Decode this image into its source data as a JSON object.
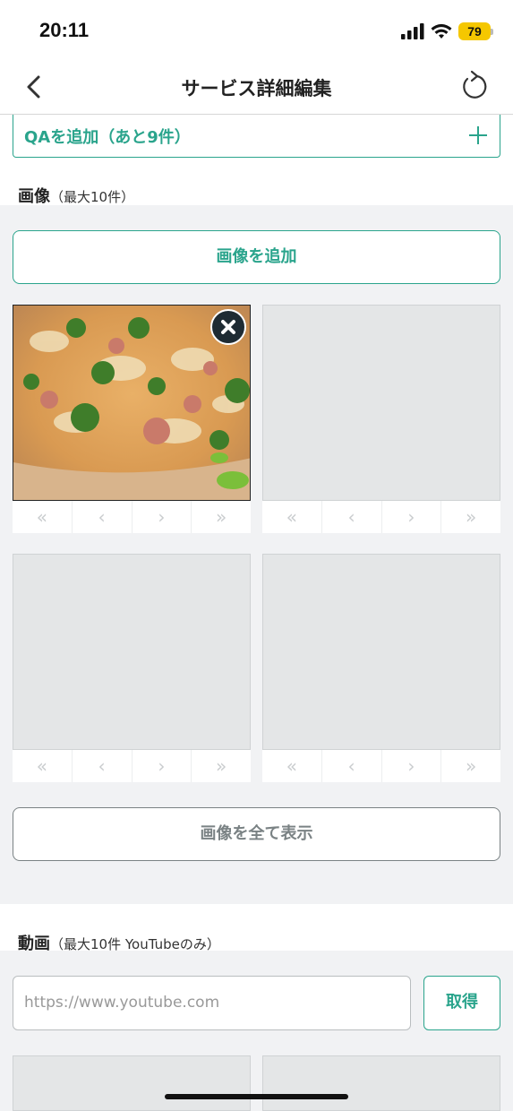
{
  "status_bar": {
    "time": "20:11",
    "battery": "79"
  },
  "nav": {
    "title": "サービス詳細編集"
  },
  "qa": {
    "add_label": "QAを追加（あと9件）"
  },
  "images": {
    "heading": "画像",
    "heading_sub": "（最大10件）",
    "add_button": "画像を追加",
    "show_all_button": "画像を全て表示",
    "controls": [
      "«",
      "‹",
      "›",
      "»"
    ],
    "tiles": [
      {
        "filled": true,
        "description": "pizza"
      },
      {
        "filled": false
      },
      {
        "filled": false
      },
      {
        "filled": false
      }
    ]
  },
  "videos": {
    "heading": "動画",
    "heading_sub": "（最大10件 YouTubeのみ）",
    "url_placeholder": "https://www.youtube.com",
    "fetch_button": "取得"
  },
  "colors": {
    "accent": "#2aa48c",
    "gray_button": "#7a8284",
    "background": "#f1f2f4"
  }
}
